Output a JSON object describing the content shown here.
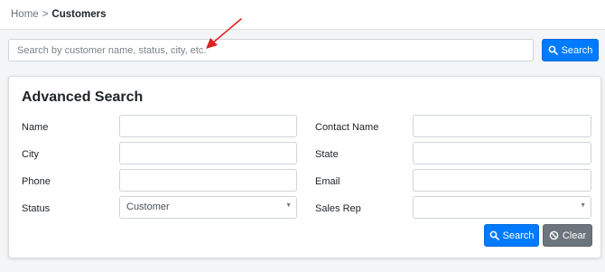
{
  "breadcrumb": {
    "home": "Home",
    "separator": ">",
    "current": "Customers"
  },
  "quick_search": {
    "placeholder": "Search by customer name, status, city, etc.",
    "value": "",
    "button_label": "Search"
  },
  "advanced_search": {
    "title": "Advanced Search",
    "fields": {
      "name": {
        "label": "Name",
        "value": ""
      },
      "contact_name": {
        "label": "Contact Name",
        "value": ""
      },
      "city": {
        "label": "City",
        "value": ""
      },
      "state": {
        "label": "State",
        "value": ""
      },
      "phone": {
        "label": "Phone",
        "value": ""
      },
      "email": {
        "label": "Email",
        "value": ""
      },
      "status": {
        "label": "Status",
        "selected": "Customer"
      },
      "sales_rep": {
        "label": "Sales Rep",
        "selected": ""
      }
    },
    "search_label": "Search",
    "clear_label": "Clear"
  },
  "colors": {
    "primary": "#007bff",
    "secondary": "#6c757d",
    "arrow": "#e02020"
  },
  "icons": {
    "search": "search-icon",
    "clear": "ban-icon",
    "dropdown": "chevron-down-icon",
    "annotation": "red-arrow-icon"
  }
}
